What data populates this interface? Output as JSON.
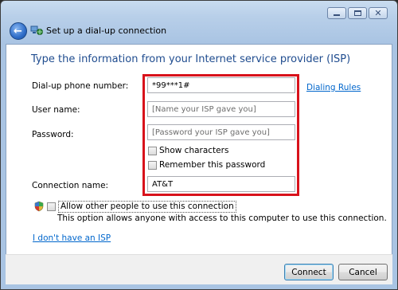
{
  "window": {
    "title": "Set up a dial-up connection",
    "caption_buttons": [
      "minimize-icon",
      "maximize-icon",
      "close-icon"
    ]
  },
  "heading": "Type the information from your Internet service provider (ISP)",
  "fields": {
    "phone": {
      "label": "Dial-up phone number:",
      "value": "*99***1#"
    },
    "username": {
      "label": "User name:",
      "placeholder": "[Name your ISP gave you]"
    },
    "password": {
      "label": "Password:",
      "placeholder": "[Password your ISP gave you]"
    },
    "connection_name": {
      "label": "Connection name:",
      "value": "AT&T"
    }
  },
  "links": {
    "dialing_rules": "Dialing Rules",
    "no_isp": "I don't have an ISP"
  },
  "checkboxes": {
    "show_characters": "Show characters",
    "remember_password": "Remember this password",
    "allow_others": "Allow other people to use this connection"
  },
  "allow_description": "This option allows anyone with access to this computer to use this connection.",
  "buttons": {
    "connect": "Connect",
    "cancel": "Cancel"
  },
  "colors": {
    "highlight_border": "#d8121b",
    "heading": "#1f4c8f",
    "link": "#0066cc"
  }
}
